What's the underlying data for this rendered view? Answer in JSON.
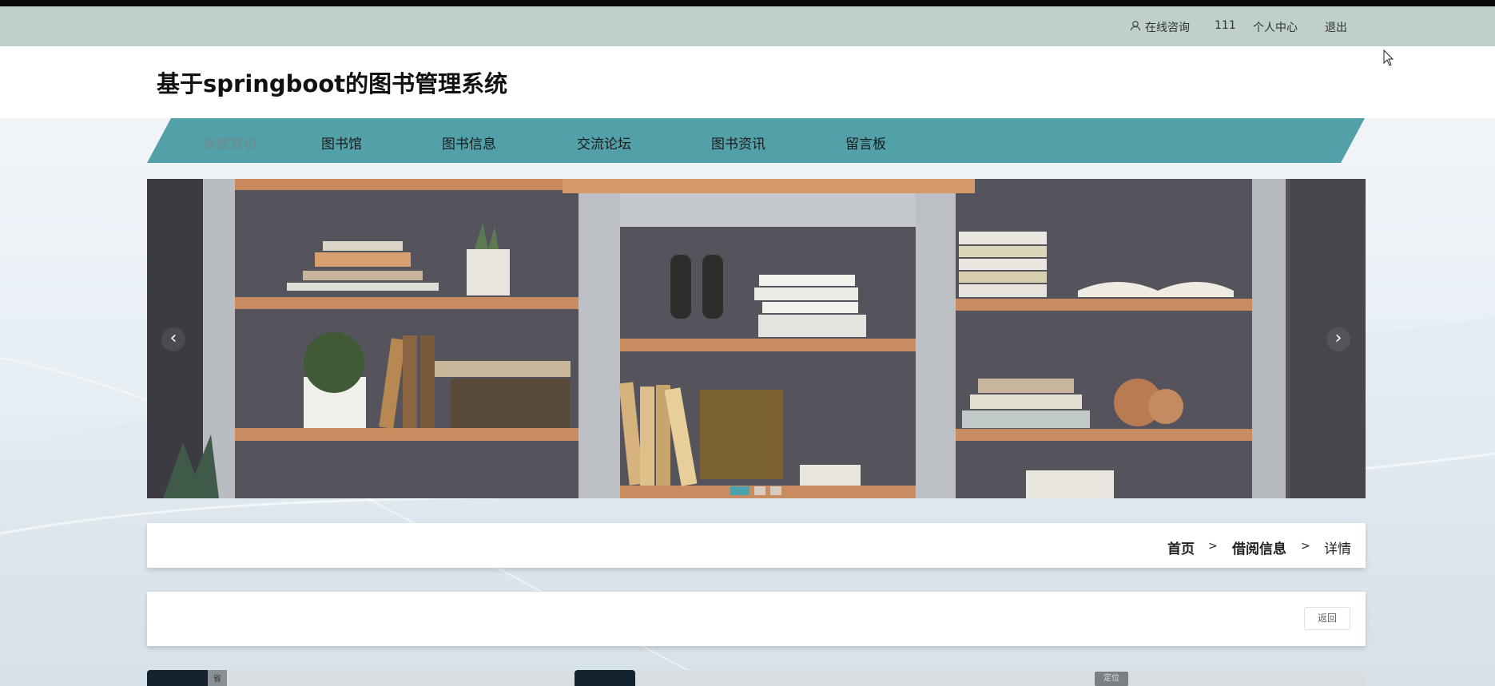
{
  "topbar": {
    "consult": "在线咨询",
    "username": "111",
    "profile": "个人中心",
    "logout": "退出"
  },
  "header": {
    "title": "基于springboot的图书管理系统"
  },
  "nav": {
    "items": [
      {
        "label": "系统首页",
        "active": true
      },
      {
        "label": "图书馆"
      },
      {
        "label": "图书信息"
      },
      {
        "label": "交流论坛"
      },
      {
        "label": "图书资讯"
      },
      {
        "label": "留言板"
      }
    ]
  },
  "banner": {
    "prev": "‹",
    "next": "›",
    "slide_count": 3,
    "active_slide": 1
  },
  "breadcrumb": {
    "home": "首页",
    "sep1": ">",
    "section": "借阅信息",
    "sep2": ">",
    "current": "详情"
  },
  "detail": {
    "back": "返回"
  },
  "bottom": {
    "locate_tag": "定位",
    "thumb_char": "省"
  },
  "colors": {
    "topbar": "#bfcfcc",
    "nav": "#52a0a8",
    "accent": "#4aa3ac"
  }
}
